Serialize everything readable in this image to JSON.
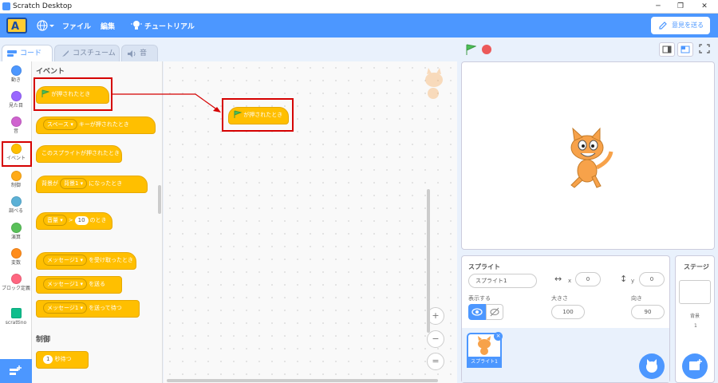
{
  "window": {
    "title": "Scratch Desktop",
    "minimize": "─",
    "restore": "❐",
    "close": "✕"
  },
  "menu": {
    "file": "ファイル",
    "edit": "編集",
    "tutorial": "チュートリアル",
    "feedback": "意見を送る"
  },
  "tabs": {
    "code": "コード",
    "costume": "コスチューム",
    "sound": "音"
  },
  "categories": [
    {
      "label": "動き",
      "color": "#4c97ff"
    },
    {
      "label": "見た目",
      "color": "#9966ff"
    },
    {
      "label": "音",
      "color": "#cf63cf"
    },
    {
      "label": "イベント",
      "color": "#ffbf00"
    },
    {
      "label": "制御",
      "color": "#ffab19"
    },
    {
      "label": "調べる",
      "color": "#5cb1d6"
    },
    {
      "label": "演算",
      "color": "#59c059"
    },
    {
      "label": "変数",
      "color": "#ff8c1a"
    },
    {
      "label": "ブロック定義",
      "color": "#ff6680"
    },
    {
      "label": "scrattino",
      "color": "#0fbd8c"
    }
  ],
  "palette": {
    "section_events": "イベント",
    "flag_clicked": "が押されたとき",
    "key_pressed_dropdown": "スペース ▾",
    "key_pressed_text": "キーが押されたとき",
    "sprite_clicked": "このスプライトが押されたとき",
    "backdrop_pre": "背景が",
    "backdrop_dropdown": "背景1 ▾",
    "backdrop_post": "になったとき",
    "sensor_dropdown": "音量 ▾",
    "sensor_gt": ">",
    "sensor_value": "10",
    "sensor_post": "のとき",
    "receive_dropdown": "メッセージ1 ▾",
    "receive_text": "を受け取ったとき",
    "broadcast_dropdown": "メッセージ1 ▾",
    "broadcast_text": "を送る",
    "broadcast_wait_dropdown": "メッセージ1 ▾",
    "broadcast_wait_text": "を送って待つ",
    "section_control": "制御",
    "wait_value": "1",
    "wait_text": "秒待つ"
  },
  "script": {
    "flag_clicked": "が押されたとき",
    "zoom_in": "+",
    "zoom_out": "−",
    "zoom_reset": "="
  },
  "sprite_info": {
    "heading": "スプライト",
    "name": "スプライト1",
    "x_label": "x",
    "x_value": "0",
    "y_label": "y",
    "y_value": "0",
    "show_label": "表示する",
    "size_label": "大きさ",
    "size_value": "100",
    "direction_label": "向き",
    "direction_value": "90",
    "thumb_name": "スプライト1"
  },
  "stage_panel": {
    "heading": "ステージ",
    "backdrops_label": "背景",
    "backdrops_count": "1"
  },
  "colors": {
    "accent": "#4c97ff",
    "events": "#ffbf00",
    "highlight": "#d50000"
  }
}
